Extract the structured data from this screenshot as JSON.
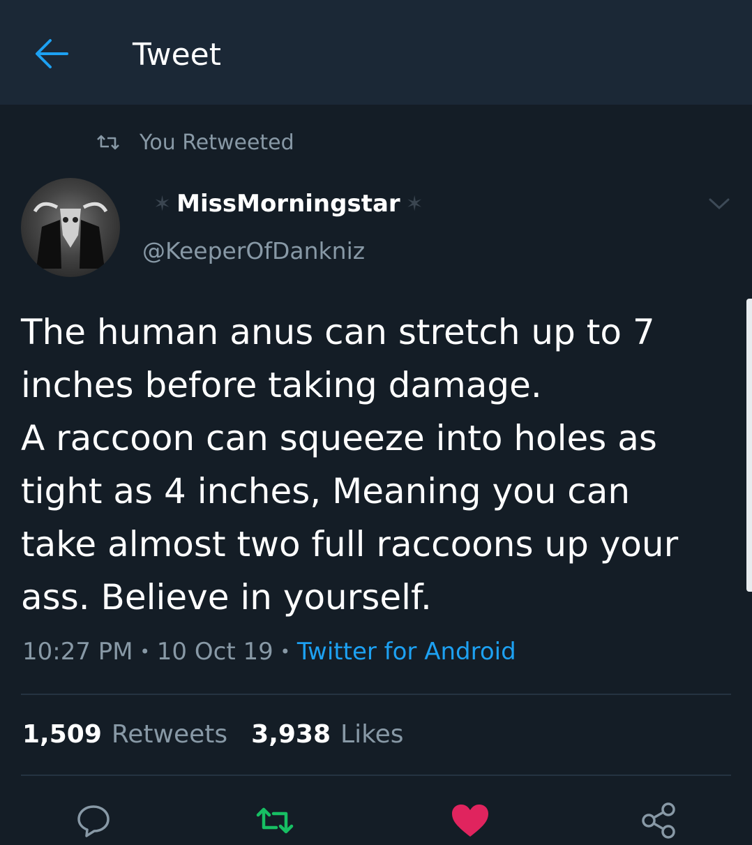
{
  "header": {
    "title": "Tweet"
  },
  "retweet_note": "You Retweeted",
  "author": {
    "display_name": "MissMorningstar",
    "handle": "@KeeperOfDankniz"
  },
  "tweet": {
    "text": "The human anus can stretch up to 7\ninches before taking damage.\nA raccoon can squeeze into holes as\ntight as 4 inches, Meaning you can\ntake almost two full raccoons up your\nass. Believe in yourself.",
    "time": "10:27 PM",
    "date": "10 Oct 19",
    "source": "Twitter for Android"
  },
  "stats": {
    "retweets_count": "1,509",
    "retweets_label": "Retweets",
    "likes_count": "3,938",
    "likes_label": "Likes"
  },
  "colors": {
    "background": "#141d26",
    "header_bg": "#1b2836",
    "accent": "#1da1f2",
    "retweet_green": "#17bf63",
    "like_red": "#e0245e",
    "muted": "#8899a6"
  },
  "actions": {
    "reply_icon": "reply-icon",
    "retweet_icon": "retweet-icon",
    "like_icon": "heart-icon",
    "share_icon": "share-icon",
    "liked": true,
    "retweeted": true
  }
}
